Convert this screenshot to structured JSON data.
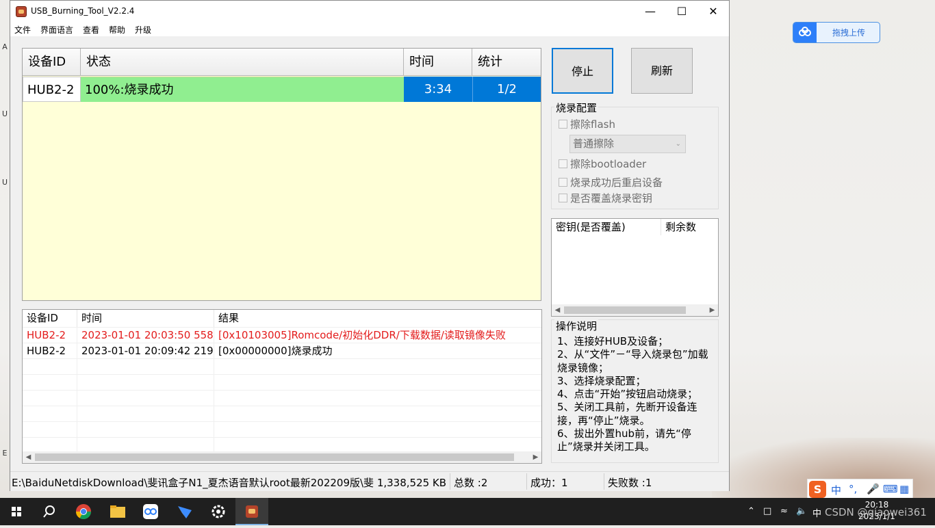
{
  "window": {
    "title": "USB_Burning_Tool_V2.2.4",
    "min_glyph": "—",
    "max_glyph": "☐",
    "close_glyph": "✕"
  },
  "menu": [
    "文件",
    "界面语言",
    "查看",
    "帮助",
    "升级"
  ],
  "device_table": {
    "headers": [
      "设备ID",
      "状态",
      "时间",
      "统计"
    ],
    "rows": [
      {
        "id": "HUB2-2",
        "status": "100%:烧录成功",
        "time": "3:34",
        "count": "1/2",
        "progress": 1.0
      }
    ]
  },
  "buttons": {
    "stop": "停止",
    "refresh": "刷新"
  },
  "burn_config": {
    "label": "烧录配置",
    "erase_flash": "擦除flash",
    "erase_mode": "普通擦除",
    "erase_bootloader": "擦除bootloader",
    "reboot_after": "烧录成功后重启设备",
    "overwrite_key": "是否覆盖烧录密钥"
  },
  "key_table": {
    "headers": [
      "密钥(是否覆盖)",
      "剩余数"
    ]
  },
  "log_table": {
    "headers": [
      "设备ID",
      "时间",
      "结果"
    ],
    "rows": [
      {
        "id": "HUB2-2",
        "time": "2023-01-01 20:03:50 558",
        "result": "[0x10103005]Romcode/初始化DDR/下载数据/读取镜像失败",
        "error": true
      },
      {
        "id": "HUB2-2",
        "time": "2023-01-01 20:09:42 219",
        "result": "[0x00000000]烧录成功",
        "error": false
      }
    ]
  },
  "instructions": {
    "label": "操作说明",
    "text": "1、连接好HUB及设备；\n2、从“文件”－“导入烧录包”加载烧录镜像；\n3、选择烧录配置；\n4、点击“开始”按钮启动烧录；\n5、关闭工具前，先断开设备连接，再“停止”烧录。\n6、拔出外置hub前，请先“停止”烧录并关闭工具。"
  },
  "status_bar": {
    "path": "E:\\BaiduNetdiskDownload\\斐讯盒子N1_夏杰语音默认root最新202209版\\斐 1,338,525 KB",
    "total": "总数 :2",
    "success": "成功：1",
    "fail": "失败数 :1"
  },
  "upload_widget": {
    "label": "拖拽上传"
  },
  "ime": {
    "logo": "S",
    "lang": "中",
    "punct": "°,"
  },
  "taskbar": {
    "apps": [
      "windows-start",
      "search",
      "chrome",
      "file-explorer",
      "baidu-netdisk",
      "feishu",
      "settings",
      "usb-burning-tool"
    ],
    "tray_lang": "中",
    "time": "20:18",
    "date": "2023/1/1"
  },
  "watermark": "CSDN @qiaowei361",
  "desktop_edge": [
    "A",
    "U",
    "U",
    "E"
  ],
  "colors": {
    "row_success": "#90ee90",
    "row_selected": "#0078d7",
    "table_bg": "#ffffd8",
    "error_text": "#e31b1b"
  }
}
